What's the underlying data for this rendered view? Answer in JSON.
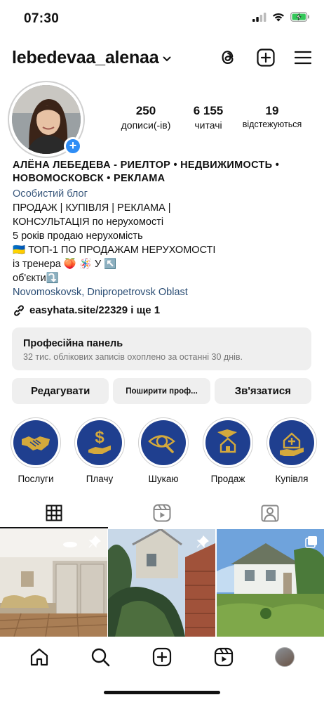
{
  "status_bar": {
    "time": "07:30"
  },
  "header": {
    "username": "lebedevaa_alenaa",
    "icons": [
      "threads-icon",
      "plus-square-icon",
      "menu-icon"
    ]
  },
  "profile": {
    "stats": [
      {
        "value": "250",
        "label": "дописи(-ів)"
      },
      {
        "value": "6 155",
        "label": "читачі"
      },
      {
        "value": "19",
        "label": "відстежуються"
      }
    ],
    "bio": {
      "name_line1": "АЛЁНА ЛЕБЕДЕВА - РИЕЛТОР • НЕДВИЖИМОСТЬ •",
      "name_line2": "НОВОМОСКОВСК • РЕКЛАМА",
      "category": "Особистий блог",
      "lines": [
        "ПРОДАЖ | КУПІВЛЯ | РЕКЛАМА |",
        "КОНСУЛЬТАЦІЯ по нерухомості",
        "5 років продаю нерухомість",
        "🇺🇦 ТОП-1 ПО ПРОДАЖАМ НЕРУХОМОСТІ",
        "із тренера 🍑 🪅 У ↖️",
        "об'єкти⤵️"
      ],
      "location": "Novomoskovsk, Dnipropetrovsk Oblast",
      "link": "easyhata.site/22329 і ще 1"
    }
  },
  "pro_panel": {
    "title": "Професійна панель",
    "subtitle": "32 тис. облікових записів охоплено за останні 30 днів."
  },
  "buttons": {
    "edit": "Редагувати",
    "share": "Поширити проф...",
    "contact": "Зв'язатися"
  },
  "highlights": [
    {
      "label": "Послуги",
      "icon": "handshake-icon"
    },
    {
      "label": "Плачу",
      "icon": "dollar-hand-icon"
    },
    {
      "label": "Шукаю",
      "icon": "eye-magnifier-icon"
    },
    {
      "label": "Продаж",
      "icon": "house-hand-icon"
    },
    {
      "label": "Купівля",
      "icon": "house-plus-hand-icon"
    }
  ],
  "tabs": [
    "grid-icon",
    "reels-icon",
    "tagged-icon"
  ],
  "posts": [
    {
      "type": "pinned",
      "scene": "interior-bedroom"
    },
    {
      "type": "pinned",
      "scene": "house-garden-fence"
    },
    {
      "type": "carousel",
      "scene": "white-house-lawn"
    }
  ],
  "colors": {
    "accent_blue": "#2e8df5",
    "highlight_bg": "#1f3f8f",
    "highlight_gold": "#d4a93c",
    "panel_bg": "#efefef",
    "link_blue": "#2a4d74"
  }
}
